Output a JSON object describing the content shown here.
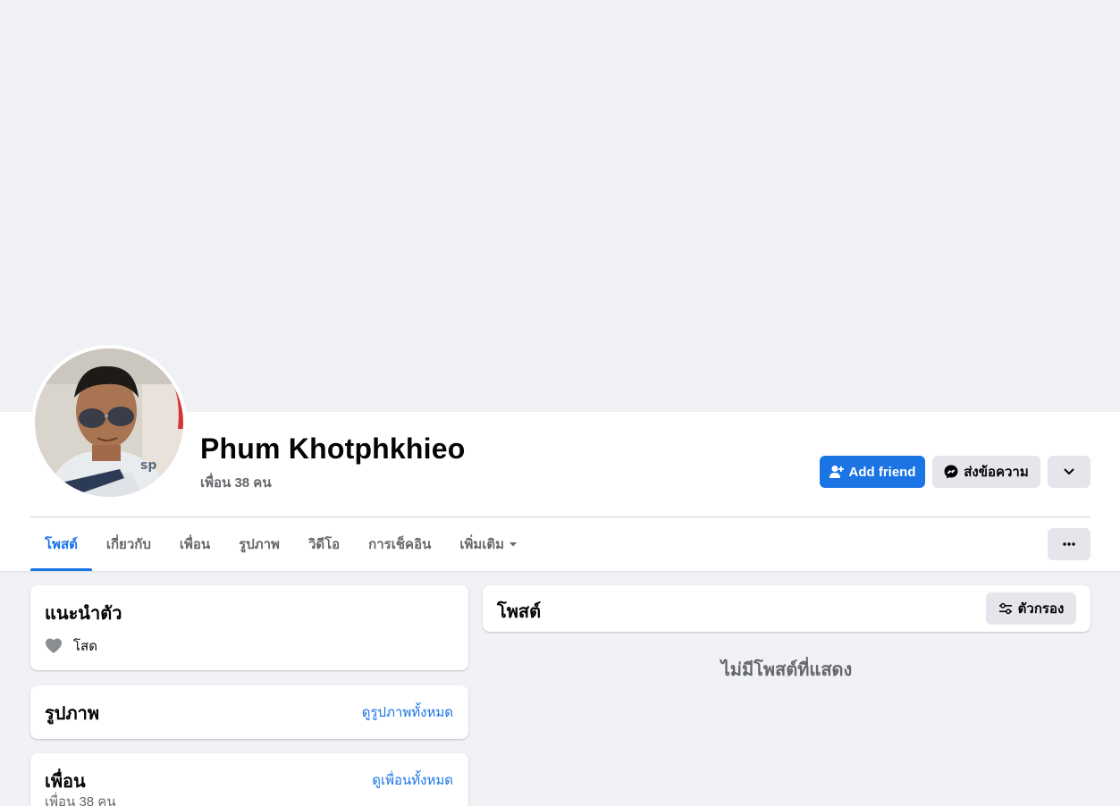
{
  "profile": {
    "name": "Phum Khotphkhieo",
    "friends_count": "เพื่อน 38 คน"
  },
  "actions": {
    "add_friend": "Add friend",
    "message": "ส่งข้อความ"
  },
  "tabs": [
    {
      "label": "โพสต์",
      "active": true
    },
    {
      "label": "เกี่ยวกับ"
    },
    {
      "label": "เพื่อน"
    },
    {
      "label": "รูปภาพ"
    },
    {
      "label": "วิดีโอ"
    },
    {
      "label": "การเช็คอิน"
    },
    {
      "label": "เพิ่มเติม"
    }
  ],
  "intro": {
    "title": "แนะนำตัว",
    "relationship": "โสด"
  },
  "photos": {
    "title": "รูปภาพ",
    "see_all": "ดูรูปภาพทั้งหมด"
  },
  "friends": {
    "title": "เพื่อน",
    "see_all": "ดูเพื่อนทั้งหมด",
    "count": "เพื่อน 38 คน"
  },
  "posts": {
    "title": "โพสต์",
    "filter": "ตัวกรอง",
    "empty": "ไม่มีโพสต์ที่แสดง"
  },
  "colors": {
    "accent": "#1b74e4",
    "background": "#f0f2f5",
    "secondary_button": "#e4e6eb",
    "muted_text": "#65676b"
  }
}
